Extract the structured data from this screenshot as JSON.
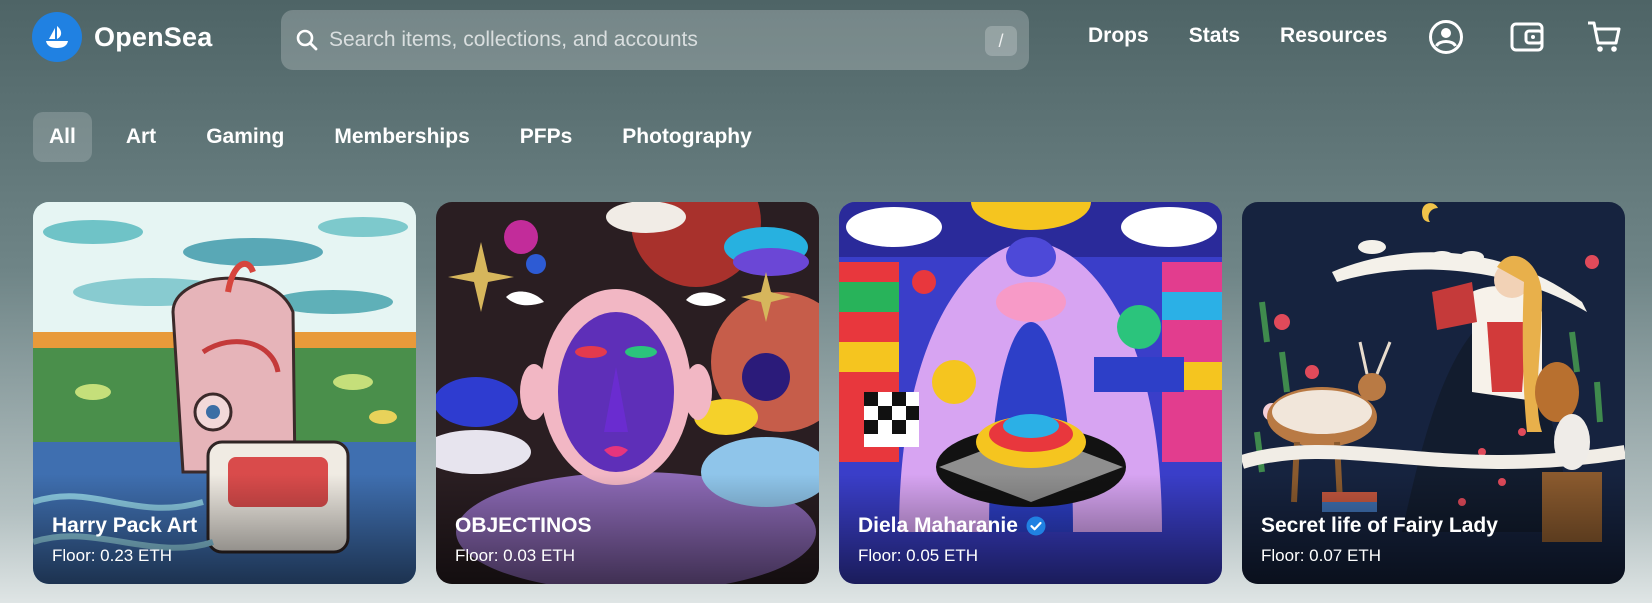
{
  "brand": {
    "name": "OpenSea",
    "color": "#2081e2"
  },
  "search": {
    "placeholder": "Search items, collections, and accounts",
    "shortcut": "/"
  },
  "nav": {
    "links": [
      "Drops",
      "Stats",
      "Resources"
    ],
    "icons": [
      "profile-icon",
      "wallet-icon",
      "cart-icon"
    ]
  },
  "tabs": [
    {
      "label": "All",
      "active": true
    },
    {
      "label": "Art",
      "active": false
    },
    {
      "label": "Gaming",
      "active": false
    },
    {
      "label": "Memberships",
      "active": false
    },
    {
      "label": "PFPs",
      "active": false
    },
    {
      "label": "Photography",
      "active": false
    }
  ],
  "cards": [
    {
      "title": "Harry Pack Art",
      "floor": "Floor: 0.23 ETH",
      "verified": false
    },
    {
      "title": "OBJECTINOS",
      "floor": "Floor: 0.03 ETH",
      "verified": false
    },
    {
      "title": "Diela Maharanie",
      "floor": "Floor: 0.05 ETH",
      "verified": true
    },
    {
      "title": "Secret life of Fairy Lady",
      "floor": "Floor: 0.07 ETH",
      "verified": false
    }
  ]
}
